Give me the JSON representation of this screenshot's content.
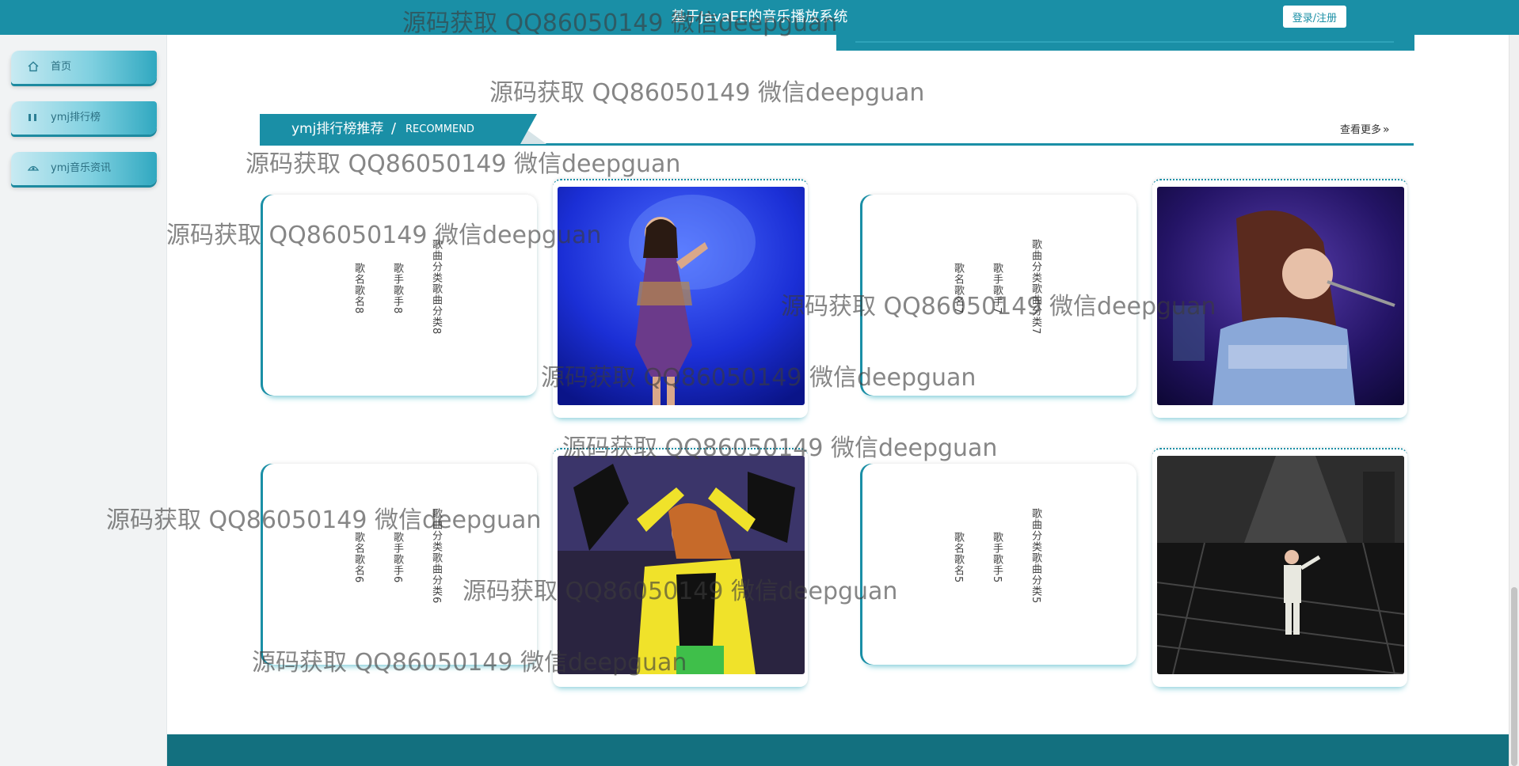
{
  "header": {
    "title": "基于JavaEE的音乐播放系统",
    "login_label": "登录/注册"
  },
  "sidebar": {
    "items": [
      {
        "label": "首页",
        "icon": "home-icon"
      },
      {
        "label": "ymj排行榜",
        "icon": "ranking-icon"
      },
      {
        "label": "ymj音乐资讯",
        "icon": "news-icon"
      }
    ]
  },
  "section": {
    "title": "ymj排行榜推荐",
    "separator": "/",
    "subtitle": "RECOMMEND",
    "more_label": "查看更多",
    "more_icon": "double-chevron-right-icon"
  },
  "cards": [
    {
      "song": "歌名歌名8",
      "singer": "歌手歌手8",
      "category": "歌曲分类歌曲分类8"
    },
    {
      "song": "歌名歌名7",
      "singer": "歌手歌手7",
      "category": "歌曲分类歌曲分类7"
    },
    {
      "song": "歌名歌名6",
      "singer": "歌手歌手6",
      "category": "歌曲分类歌曲分类6"
    },
    {
      "song": "歌名歌名5",
      "singer": "歌手歌手5",
      "category": "歌曲分类歌曲分类5"
    }
  ],
  "watermark": "源码获取 QQ86050149 微信deepguan",
  "colors": {
    "accent": "#1a8fa6",
    "footer": "#13707f"
  }
}
